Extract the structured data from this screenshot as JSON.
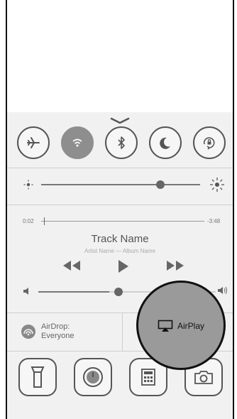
{
  "music": {
    "elapsed": "0:02",
    "remaining": "-3:48",
    "track_name": "Track Name",
    "artist_album": "Artist Name — Album Name",
    "progress_fraction": 0.02
  },
  "brightness": {
    "level_fraction": 0.75
  },
  "volume": {
    "level_fraction": 0.45
  },
  "airdrop": {
    "line1": "AirDrop:",
    "line2": "Everyone"
  },
  "airplay": {
    "label": "AirPlay"
  },
  "toggles": [
    {
      "icon": "airplane-icon",
      "active": false
    },
    {
      "icon": "wifi-icon",
      "active": true
    },
    {
      "icon": "bluetooth-icon",
      "active": false
    },
    {
      "icon": "moon-icon",
      "active": false
    },
    {
      "icon": "rotation-lock-icon",
      "active": false
    }
  ],
  "shortcuts": [
    "flashlight-icon",
    "timer-icon",
    "calculator-icon",
    "camera-icon"
  ]
}
